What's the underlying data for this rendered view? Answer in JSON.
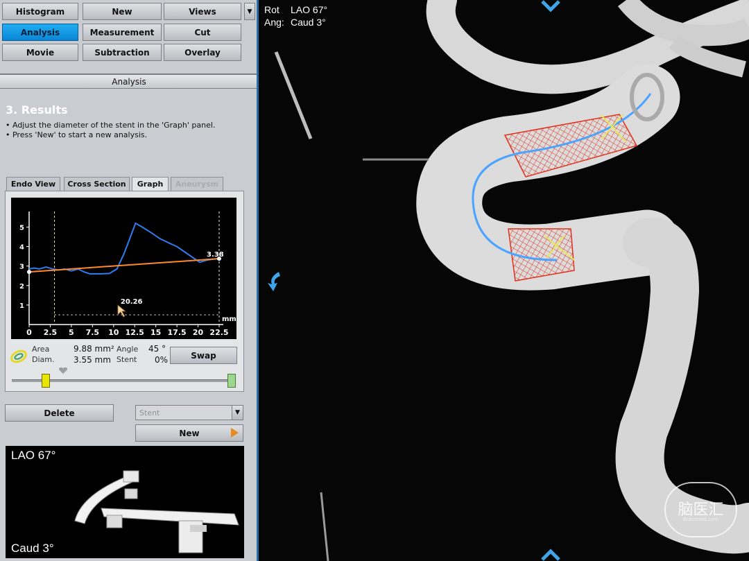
{
  "toolbar": {
    "buttons": [
      "Histogram",
      "New",
      "Views",
      "Analysis",
      "Measurement",
      "Cut",
      "Movie",
      "Subtraction",
      "Overlay"
    ],
    "active": "Analysis"
  },
  "analysis_bar": "Analysis",
  "results": {
    "title": "3.  Results",
    "line1": "• Adjust the diameter of the stent in the 'Graph' panel.",
    "line2": "• Press 'New' to start a new analysis."
  },
  "tabs": [
    "Endo View",
    "Cross Section",
    "Graph",
    "Aneurysm"
  ],
  "chart_data": {
    "type": "line",
    "x_ticks": [
      "0",
      "2.5",
      "5",
      "7.5",
      "10",
      "12.5",
      "15",
      "17.5",
      "20",
      "22.5"
    ],
    "y_ticks": [
      "1",
      "2",
      "3",
      "4",
      "5"
    ],
    "xlabel": "mm",
    "xlim": [
      0,
      22.5
    ],
    "ylim": [
      0,
      5.8
    ],
    "series": [
      {
        "color": "#2f7df0",
        "points": [
          [
            0,
            2.85
          ],
          [
            0.6,
            2.9
          ],
          [
            1.2,
            2.85
          ],
          [
            2,
            2.95
          ],
          [
            2.8,
            2.85
          ],
          [
            3.5,
            2.8
          ],
          [
            4.2,
            2.85
          ],
          [
            5,
            2.75
          ],
          [
            5.8,
            2.85
          ],
          [
            6.5,
            2.7
          ],
          [
            7.2,
            2.6
          ],
          [
            8.5,
            2.6
          ],
          [
            9.5,
            2.62
          ],
          [
            10.4,
            2.85
          ],
          [
            11.2,
            3.6
          ],
          [
            12,
            4.5
          ],
          [
            12.6,
            5.2
          ],
          [
            13.4,
            5.0
          ],
          [
            14.5,
            4.7
          ],
          [
            15.5,
            4.4
          ],
          [
            16.5,
            4.2
          ],
          [
            17.5,
            4.0
          ],
          [
            18.5,
            3.7
          ],
          [
            19.5,
            3.4
          ],
          [
            20.2,
            3.2
          ],
          [
            21,
            3.3
          ],
          [
            21.7,
            3.35
          ],
          [
            22.5,
            3.38
          ]
        ]
      },
      {
        "color": "#ff8a2a",
        "points": [
          [
            0,
            2.7
          ],
          [
            22.5,
            3.38
          ]
        ]
      }
    ],
    "annotations": {
      "end_value": "3.38",
      "cursor_value": "20.26",
      "cursor_x": 10.5,
      "marker_lines_x": [
        3,
        22.5
      ]
    }
  },
  "stats": {
    "area_label": "Area",
    "area_value": "9.88 mm²",
    "diam_label": "Diam.",
    "diam_value": "3.55 mm",
    "angle_label": "Angle",
    "angle_value": "45 °",
    "stent_label": "Stent",
    "stent_value": "0%"
  },
  "slider": {
    "left_position": 0.15,
    "right_position": 1.0
  },
  "buttons": {
    "swap": "Swap",
    "delete": "Delete",
    "new": "New"
  },
  "stent_select": {
    "value": "Stent"
  },
  "camera": {
    "top_label": "LAO   67°",
    "bottom_label": "Caud   3°"
  },
  "viewport": {
    "rot_label": "Rot",
    "rot_value": "LAO 67°",
    "ang_label": "Ang:",
    "ang_value": "Caud  3°"
  },
  "watermark": {
    "title": "脑医汇",
    "subtitle": "Brainmed.com"
  },
  "colors": {
    "active_button": "#1aa3ec",
    "stent_mesh": "#e0301a",
    "centerline": "#4aa3ff"
  }
}
